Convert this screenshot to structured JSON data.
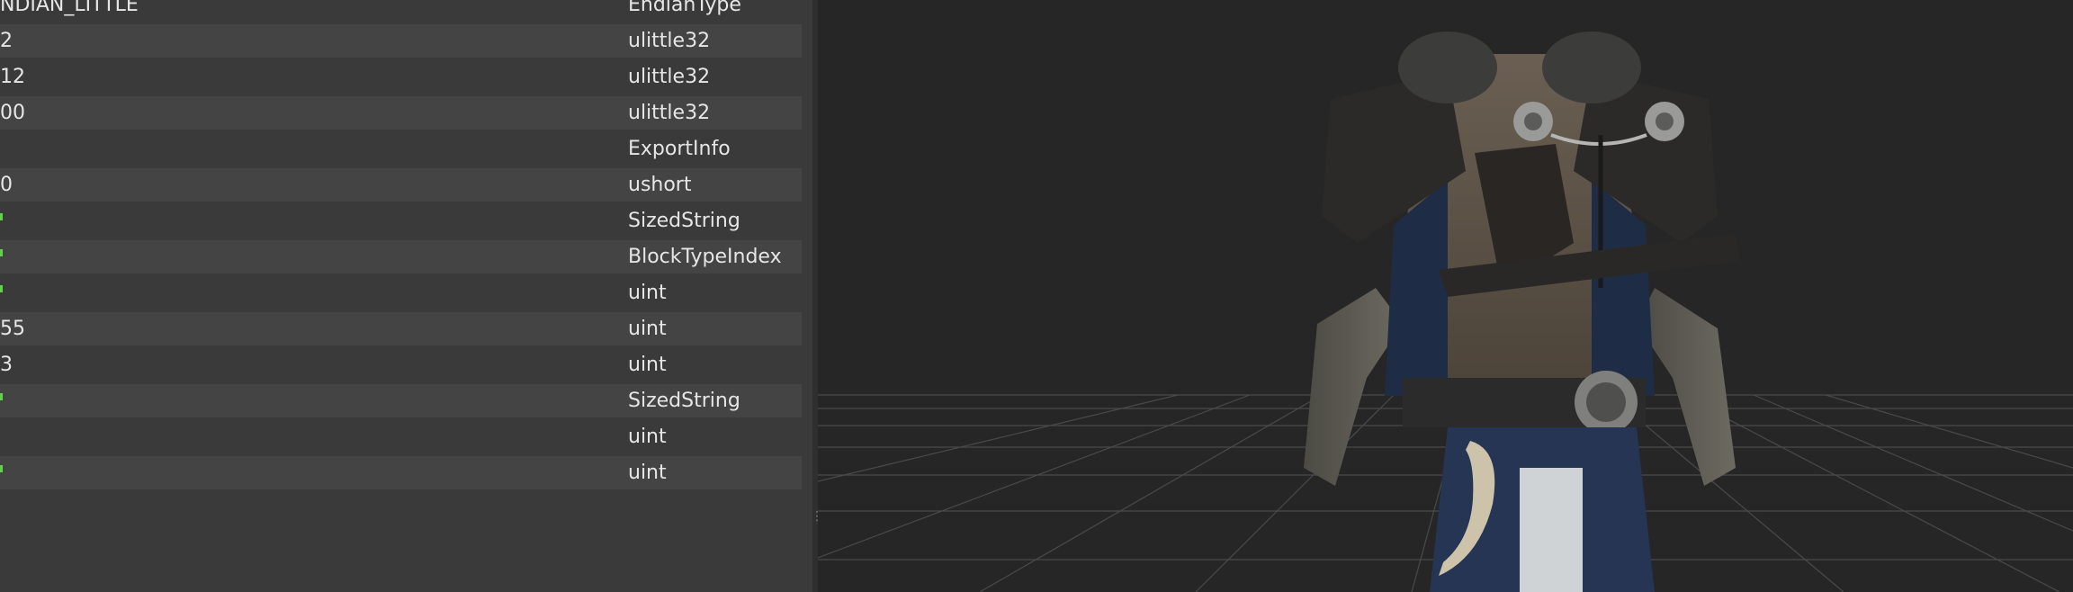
{
  "tree_rows": [
    {
      "value": "NDIAN_LITTLE",
      "type": "EndianType",
      "marked": false
    },
    {
      "value": "2",
      "type": "ulittle32",
      "marked": false
    },
    {
      "value": "12",
      "type": "ulittle32",
      "marked": false
    },
    {
      "value": "00",
      "type": "ulittle32",
      "marked": false
    },
    {
      "value": "",
      "type": "ExportInfo",
      "marked": false
    },
    {
      "value": "0",
      "type": "ushort",
      "marked": false
    },
    {
      "value": "",
      "type": "SizedString",
      "marked": true
    },
    {
      "value": "",
      "type": "BlockTypeIndex",
      "marked": true
    },
    {
      "value": "",
      "type": "uint",
      "marked": true
    },
    {
      "value": "55",
      "type": "uint",
      "marked": false
    },
    {
      "value": "3",
      "type": "uint",
      "marked": false
    },
    {
      "value": "",
      "type": "SizedString",
      "marked": true
    },
    {
      "value": "",
      "type": "uint",
      "marked": false
    },
    {
      "value": "",
      "type": "uint",
      "marked": true
    }
  ],
  "colors": {
    "panel_bg": "#3a3a3a",
    "row_alt_bg": "#444444",
    "viewport_bg": "#262626",
    "grid": "#4a4a4a",
    "marker": "#5fd34a"
  },
  "viewport": {
    "model": "armor-jacket-3d-model",
    "grid": true
  }
}
